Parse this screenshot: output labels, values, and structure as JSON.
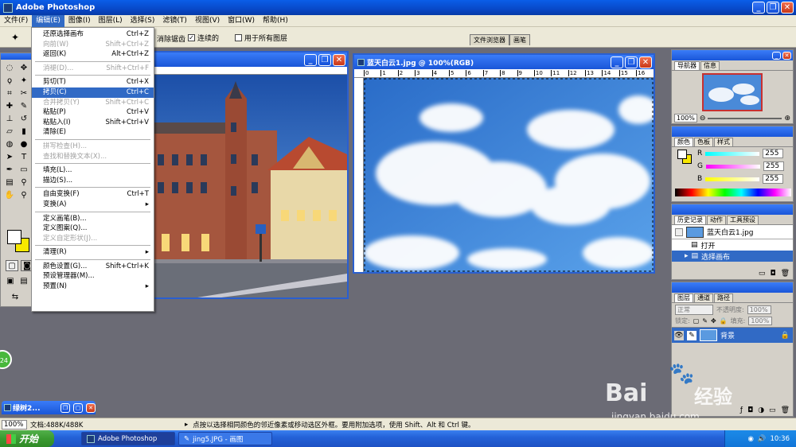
{
  "app": {
    "title": "Adobe Photoshop"
  },
  "menubar": [
    "文件(F)",
    "编辑(E)",
    "图像(I)",
    "图层(L)",
    "选择(S)",
    "滤镜(T)",
    "视图(V)",
    "窗口(W)",
    "帮助(H)"
  ],
  "options": {
    "antialias": "消除锯齿",
    "contiguous": "连续的",
    "all_layers": "用于所有图层",
    "tab_browser": "文件浏览器",
    "tab_brush": "画笔"
  },
  "edit_menu": [
    {
      "label": "还原选择画布",
      "shortcut": "Ctrl+Z",
      "disabled": false,
      "hl": false
    },
    {
      "label": "向前(W)",
      "shortcut": "Shift+Ctrl+Z",
      "disabled": true,
      "hl": false
    },
    {
      "label": "返回(K)",
      "shortcut": "Alt+Ctrl+Z",
      "disabled": false,
      "hl": false
    },
    {
      "sep": true
    },
    {
      "label": "消褪(D)...",
      "shortcut": "Shift+Ctrl+F",
      "disabled": true,
      "hl": false
    },
    {
      "sep": true
    },
    {
      "label": "剪切(T)",
      "shortcut": "Ctrl+X",
      "disabled": false,
      "hl": false
    },
    {
      "label": "拷贝(C)",
      "shortcut": "Ctrl+C",
      "disabled": false,
      "hl": true
    },
    {
      "label": "合并拷贝(Y)",
      "shortcut": "Shift+Ctrl+C",
      "disabled": true,
      "hl": false
    },
    {
      "label": "粘贴(P)",
      "shortcut": "Ctrl+V",
      "disabled": false,
      "hl": false
    },
    {
      "label": "粘贴入(I)",
      "shortcut": "Shift+Ctrl+V",
      "disabled": false,
      "hl": false
    },
    {
      "label": "清除(E)",
      "shortcut": "",
      "disabled": false,
      "hl": false
    },
    {
      "sep": true
    },
    {
      "label": "拼写检查(H)...",
      "shortcut": "",
      "disabled": true,
      "hl": false
    },
    {
      "label": "查找和替换文本(X)...",
      "shortcut": "",
      "disabled": true,
      "hl": false
    },
    {
      "sep": true
    },
    {
      "label": "填充(L)...",
      "shortcut": "",
      "disabled": false,
      "hl": false
    },
    {
      "label": "描边(S)...",
      "shortcut": "",
      "disabled": false,
      "hl": false
    },
    {
      "sep": true
    },
    {
      "label": "自由变换(F)",
      "shortcut": "Ctrl+T",
      "disabled": false,
      "hl": false
    },
    {
      "label": "变换(A)",
      "shortcut": "▸",
      "disabled": false,
      "hl": false
    },
    {
      "sep": true
    },
    {
      "label": "定义画笔(B)...",
      "shortcut": "",
      "disabled": false,
      "hl": false
    },
    {
      "label": "定义图案(Q)...",
      "shortcut": "",
      "disabled": false,
      "hl": false
    },
    {
      "label": "定义自定形状(J)...",
      "shortcut": "",
      "disabled": true,
      "hl": false
    },
    {
      "sep": true
    },
    {
      "label": "清理(R)",
      "shortcut": "▸",
      "disabled": false,
      "hl": false
    },
    {
      "sep": true
    },
    {
      "label": "颜色设置(G)...",
      "shortcut": "Shift+Ctrl+K",
      "disabled": false,
      "hl": false
    },
    {
      "label": "预设管理器(M)...",
      "shortcut": "",
      "disabled": false,
      "hl": false
    },
    {
      "label": "预置(N)",
      "shortcut": "▸",
      "disabled": false,
      "hl": false
    }
  ],
  "doc_window": {
    "title": "蓝天白云1.jpg @ 100%(RGB)",
    "ruler": [
      "0",
      "1",
      "2",
      "3",
      "4",
      "5",
      "6",
      "7",
      "8",
      "9",
      "10",
      "11",
      "12",
      "13",
      "14",
      "15",
      "16"
    ]
  },
  "navigator": {
    "tabs": [
      "导航器",
      "信息"
    ],
    "zoom": "100%"
  },
  "color_panel": {
    "tabs": [
      "颜色",
      "色板",
      "样式"
    ],
    "r_label": "R",
    "g_label": "G",
    "b_label": "B",
    "r": "255",
    "g": "255",
    "b": "255"
  },
  "history": {
    "tabs": [
      "历史记录",
      "动作",
      "工具预设"
    ],
    "snapshot": "蓝天白云1.jpg",
    "items": [
      "打开",
      "选择画布"
    ]
  },
  "layers": {
    "tabs": [
      "图层",
      "通道",
      "路径"
    ],
    "blend": "正常",
    "opacity_label": "不透明度:",
    "opacity": "100%",
    "lock_label": "锁定:",
    "fill_label": "填充:",
    "fill": "100%",
    "layer_name": "背景"
  },
  "minimized": {
    "label": "绿树2..."
  },
  "status": {
    "zoom": "100%",
    "doc": "文档:488K/488K",
    "hint": "点按以选择相同颜色的邻近像素或移动选区外框。要用附加选项，使用 Shift、Alt 和 Ctrl 键。"
  },
  "badge": "24",
  "watermark": {
    "brand": "Bai",
    "brand2": "经验",
    "url": "jingyan.baidu.com"
  },
  "taskbar": {
    "start": "开始",
    "tasks": [
      "Adobe Photoshop",
      "jing5.JPG - 画图"
    ],
    "clock": "10:36"
  },
  "colors": {
    "xp_blue": "#0848c8",
    "highlight": "#316ac5",
    "panel": "#d4d0c8",
    "sky": "#3c86dc"
  }
}
